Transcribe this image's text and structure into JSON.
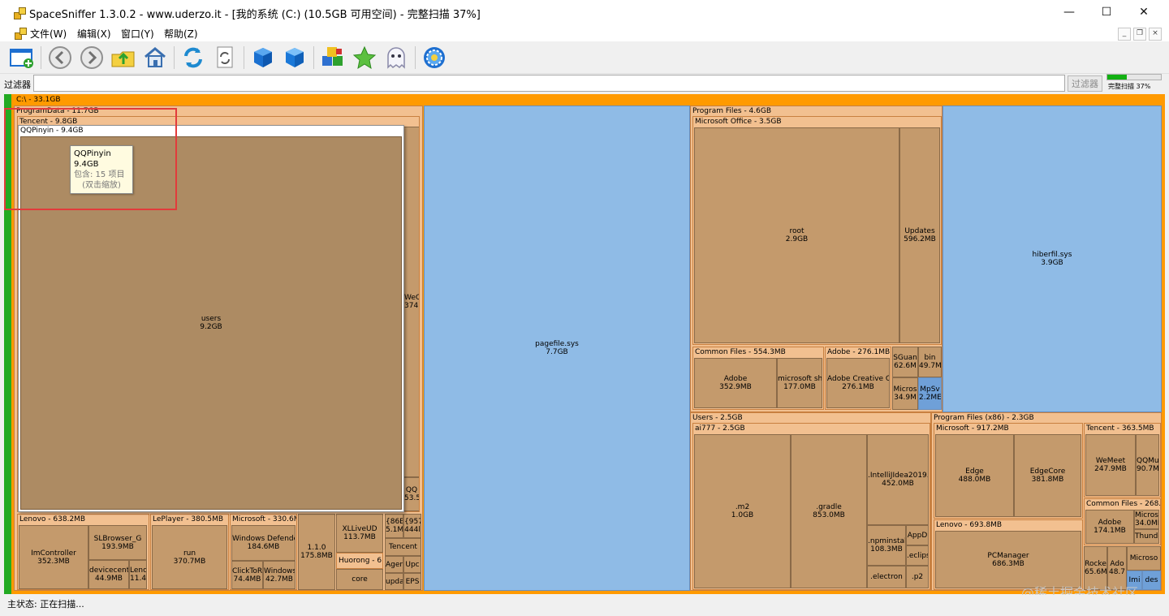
{
  "window": {
    "title": "SpaceSniffer 1.3.0.2 - www.uderzo.it - [我的系统 (C:) (10.5GB 可用空间) - 完整扫描 37%]"
  },
  "window_controls": {
    "minimize": "—",
    "maximize": "☐",
    "close": "✕"
  },
  "menu": {
    "items": [
      "文件(W)",
      "编辑(X)",
      "窗口(Y)",
      "帮助(Z)"
    ]
  },
  "mdi_controls": [
    "_",
    "❐",
    "×"
  ],
  "toolbar": {
    "buttons": [
      "new-window-icon",
      "back-icon",
      "forward-icon",
      "parent-folder-icon",
      "home-icon",
      "refresh-icon",
      "rescan-icon",
      "blue-cube-icon",
      "blue-cube-2-icon",
      "blocks-icon",
      "star-icon",
      "ghost-icon",
      "settings-gear-icon"
    ]
  },
  "filter": {
    "label": "过滤器",
    "value": "",
    "button": "过滤器"
  },
  "scan": {
    "progress_percent": 37,
    "label": "完整扫描 37%"
  },
  "treemap": {
    "root": "C:\\ - 33.1GB",
    "programdata": "ProgramData - 11.7GB",
    "tencent": "Tencent - 9.8GB",
    "qqpinyin": "QQPinyin - 9.4GB",
    "users_dir": {
      "name": "users",
      "size": "9.2GB"
    },
    "wec": {
      "name": "WeC",
      "size": "374."
    },
    "qq": {
      "name": "QQ",
      "size": "53.5"
    },
    "lenovo": {
      "title": "Lenovo - 638.2MB",
      "imcontroller": {
        "name": "ImController",
        "size": "352.3MB"
      },
      "slbrowser": {
        "name": "SLBrowser_G",
        "size": "193.9MB"
      },
      "devicecenter": {
        "name": "devicecente",
        "size": "44.9MB"
      },
      "lenc": {
        "name": "Lenc",
        "size": "11.4"
      }
    },
    "leplayer": {
      "title": "LePlayer - 380.5MB",
      "run": {
        "name": "run",
        "size": "370.7MB"
      }
    },
    "microsoft_pd": {
      "title": "Microsoft - 330.6MB",
      "defender": {
        "name": "Windows Defender",
        "size": "184.6MB"
      },
      "clicktorun": {
        "name": "ClickToRu",
        "size": "74.4MB"
      },
      "windows": {
        "name": "Windows",
        "size": "42.7MB"
      }
    },
    "v110": {
      "name": "1.1.0",
      "size": "175.8MB"
    },
    "xllive": {
      "name": "XLLiveUD",
      "size": "113.7MB"
    },
    "huorong": "Huorong - 61.",
    "core": "core",
    "s86b": {
      "name": "{86B",
      "size": "5.1M"
    },
    "s957": {
      "name": "{957",
      "size": "444l"
    },
    "tencent_small": "Tencent",
    "agent": "Ager",
    "upc": "Upc",
    "upda": "upda",
    "eps": "EPS",
    "pagefile": {
      "name": "pagefile.sys",
      "size": "7.7GB"
    },
    "program_files": "Program Files - 4.6GB",
    "ms_office": "Microsoft Office - 3.5GB",
    "root_dir": {
      "name": "root",
      "size": "2.9GB"
    },
    "updates": {
      "name": "Updates",
      "size": "596.2MB"
    },
    "common_files": "Common Files - 554.3MB",
    "adobe_cf": {
      "name": "Adobe",
      "size": "352.9MB"
    },
    "ms_shared": {
      "name": "microsoft shar",
      "size": "177.0MB"
    },
    "adobe_pf": "Adobe - 276.1MB",
    "adobe_cc": {
      "name": "Adobe Creative C",
      "size": "276.1MB"
    },
    "sguan": {
      "name": "SGuan",
      "size": "62.6M"
    },
    "bin": {
      "name": "bin",
      "size": "49.7M"
    },
    "micros_pf": {
      "name": "Micros",
      "size": "34.9M"
    },
    "mpsv": {
      "name": "MpSv",
      "size": "2.2ME"
    },
    "hiberfil": {
      "name": "hiberfil.sys",
      "size": "3.9GB"
    },
    "users": "Users - 2.5GB",
    "ai777": "ai777 - 2.5GB",
    "m2": {
      "name": ".m2",
      "size": "1.0GB"
    },
    "gradle": {
      "name": ".gradle",
      "size": "853.0MB"
    },
    "intellij": {
      "name": ".IntelliJIdea2019.",
      "size": "452.0MB"
    },
    "npminstall": {
      "name": ".npminstall",
      "size": "108.3MB"
    },
    "appd": "AppD",
    "eclips": ".eclips",
    "electron": ".electron",
    "p2": ".p2",
    "pf86": "Program Files (x86) - 2.3GB",
    "ms86": "Microsoft - 917.2MB",
    "edge": {
      "name": "Edge",
      "size": "488.0MB"
    },
    "edgecore": {
      "name": "EdgeCore",
      "size": "381.8MB"
    },
    "tencent86": "Tencent - 363.5MB",
    "wemeet": {
      "name": "WeMeet",
      "size": "247.9MB"
    },
    "qqmu": {
      "name": "QQMu",
      "size": "90.7M"
    },
    "common86": "Common Files - 268.3",
    "adobe86": {
      "name": "Adobe",
      "size": "174.1MB"
    },
    "micros86": {
      "name": "Microsc",
      "size": "34.0MI"
    },
    "thunde": "Thunde",
    "lenovo86": "Lenovo - 693.8MB",
    "pcmanager": {
      "name": "PCManager",
      "size": "686.3MB"
    },
    "rocke": {
      "name": "Rocke",
      "size": "65.6M"
    },
    "ado": {
      "name": "Ado",
      "size": "48.7"
    },
    "microso86": "Microso",
    "imi": "Imi",
    "des": "des"
  },
  "tooltip": {
    "name": "QQPinyin",
    "size": "9.4GB",
    "contains": "包含: 15 项目",
    "hint": "(双击缩放)"
  },
  "watermark": "@稀土掘金技术社区",
  "status": {
    "text": "主状态: 正在扫描..."
  }
}
